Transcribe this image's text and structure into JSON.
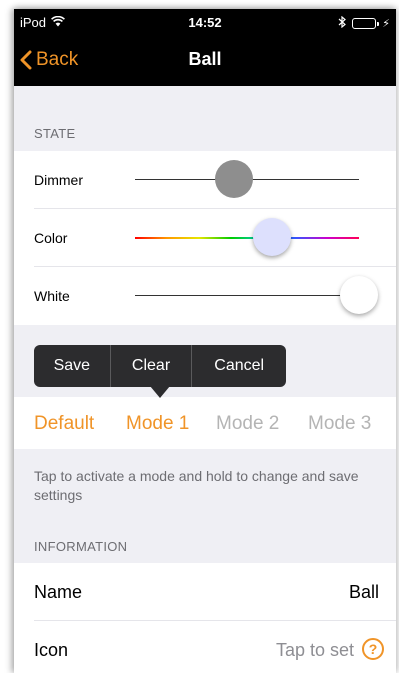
{
  "status_bar": {
    "carrier": "iPod",
    "time": "14:52"
  },
  "nav": {
    "back_label": "Back",
    "title": "Ball"
  },
  "accent_color": "#f09428",
  "state": {
    "header": "STATE",
    "sliders": [
      {
        "label": "Dimmer",
        "level": 0.44
      },
      {
        "label": "Color",
        "level": 0.61
      },
      {
        "label": "White",
        "level": 1.0
      }
    ]
  },
  "popup_menu": {
    "items": [
      "Save",
      "Clear",
      "Cancel"
    ]
  },
  "modes": {
    "items": [
      {
        "label": "Default",
        "active": true
      },
      {
        "label": "Mode 1",
        "active": true
      },
      {
        "label": "Mode 2",
        "active": false
      },
      {
        "label": "Mode 3",
        "active": false
      }
    ],
    "hint": "Tap to activate a mode and hold to change and save settings"
  },
  "information": {
    "header": "INFORMATION",
    "rows": [
      {
        "label": "Name",
        "value": "Ball"
      },
      {
        "label": "Icon",
        "value": "Tap to set"
      }
    ]
  }
}
